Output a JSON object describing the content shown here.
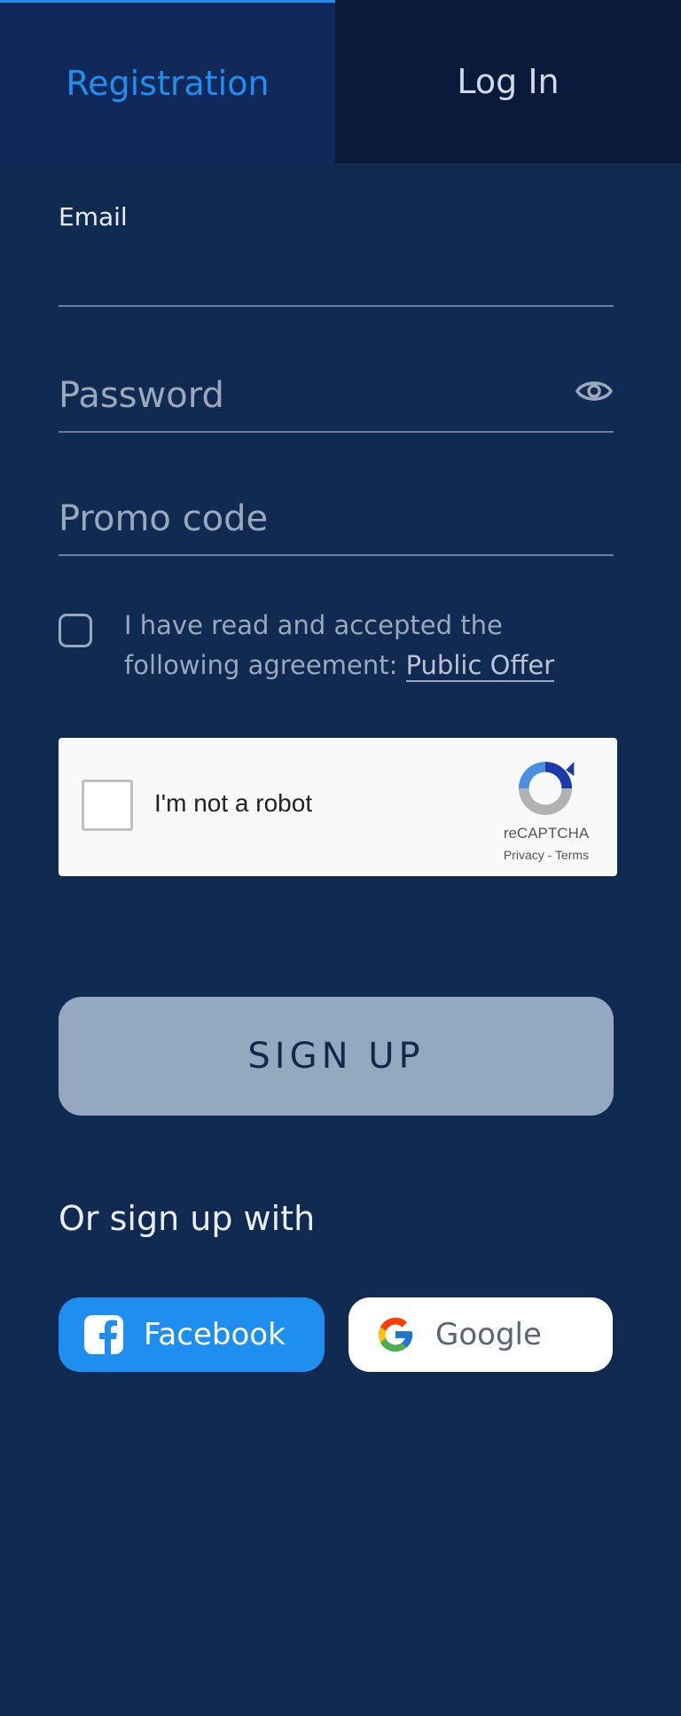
{
  "tabs": {
    "registration": "Registration",
    "login": "Log In"
  },
  "form": {
    "email_label": "Email",
    "email_value": "",
    "password_placeholder": "Password",
    "promo_placeholder": "Promo code",
    "agreement_text": "I have read and accepted the following agreement: ",
    "agreement_link": "Public Offer",
    "agreement_checked": false
  },
  "recaptcha": {
    "label": "I'm not a robot",
    "brand": "reCAPTCHA",
    "links": "Privacy - Terms"
  },
  "signup_button": "SIGN UP",
  "social": {
    "heading": "Or sign up with",
    "facebook": "Facebook",
    "google": "Google"
  },
  "colors": {
    "background": "#112a52",
    "accent": "#1e8ff0",
    "button_disabled": "#94a9c0"
  },
  "icons": [
    "eye-icon",
    "facebook-icon",
    "google-icon",
    "recaptcha-icon"
  ]
}
